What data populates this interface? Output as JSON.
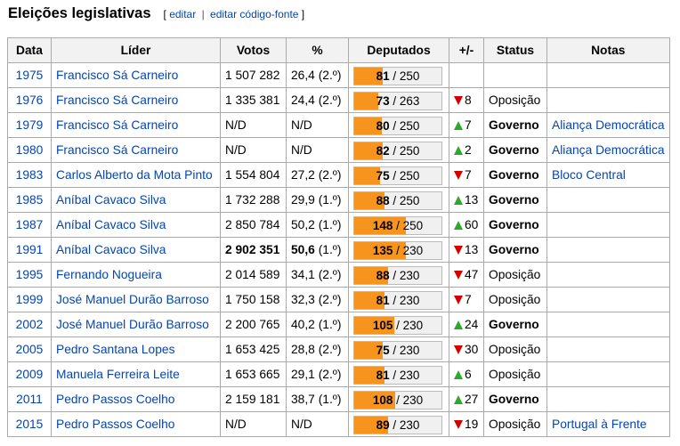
{
  "section": {
    "title": "Eleições legislativas",
    "edit_open": "[",
    "edit_label": "editar",
    "edit_sep": "|",
    "edit_source_label": "editar código-fonte",
    "edit_close": "]"
  },
  "table": {
    "headers": [
      "Data",
      "Líder",
      "Votos",
      "%",
      "Deputados",
      "+/-",
      "Status",
      "Notas"
    ],
    "rows": [
      {
        "year": "1975",
        "leader": "Francisco Sá Carneiro",
        "votes": "1 507 282",
        "pct": "26,4",
        "pos": "(2.º)",
        "seats": "81",
        "total": "250",
        "seat_fraction": 0.324,
        "dir": "",
        "change": "",
        "status": "",
        "status_bold": false,
        "notes": "",
        "bold_votes": false
      },
      {
        "year": "1976",
        "leader": "Francisco Sá Carneiro",
        "votes": "1 335 381",
        "pct": "24,4",
        "pos": "(2.º)",
        "seats": "73",
        "total": "263",
        "seat_fraction": 0.278,
        "dir": "down",
        "change": "8",
        "status": "Oposição",
        "status_bold": false,
        "notes": "",
        "bold_votes": false
      },
      {
        "year": "1979",
        "leader": "Francisco Sá Carneiro",
        "votes": "N/D",
        "pct": "N/D",
        "pos": "",
        "seats": "80",
        "total": "250",
        "seat_fraction": 0.32,
        "dir": "up",
        "change": "7",
        "status": "Governo",
        "status_bold": true,
        "notes": "Aliança Democrática",
        "bold_votes": false
      },
      {
        "year": "1980",
        "leader": "Francisco Sá Carneiro",
        "votes": "N/D",
        "pct": "N/D",
        "pos": "",
        "seats": "82",
        "total": "250",
        "seat_fraction": 0.328,
        "dir": "up",
        "change": "2",
        "status": "Governo",
        "status_bold": true,
        "notes": "Aliança Democrática",
        "bold_votes": false
      },
      {
        "year": "1983",
        "leader": "Carlos Alberto da Mota Pinto",
        "votes": "1 554 804",
        "pct": "27,2",
        "pos": "(2.º)",
        "seats": "75",
        "total": "250",
        "seat_fraction": 0.3,
        "dir": "down",
        "change": "7",
        "status": "Governo",
        "status_bold": true,
        "notes": "Bloco Central",
        "bold_votes": false
      },
      {
        "year": "1985",
        "leader": "Aníbal Cavaco Silva",
        "votes": "1 732 288",
        "pct": "29,9",
        "pos": "(1.º)",
        "seats": "88",
        "total": "250",
        "seat_fraction": 0.352,
        "dir": "up",
        "change": "13",
        "status": "Governo",
        "status_bold": true,
        "notes": "",
        "bold_votes": false
      },
      {
        "year": "1987",
        "leader": "Aníbal Cavaco Silva",
        "votes": "2 850 784",
        "pct": "50,2",
        "pos": "(1.º)",
        "seats": "148",
        "total": "250",
        "seat_fraction": 0.592,
        "dir": "up",
        "change": "60",
        "status": "Governo",
        "status_bold": true,
        "notes": "",
        "bold_votes": false
      },
      {
        "year": "1991",
        "leader": "Aníbal Cavaco Silva",
        "votes": "2 902 351",
        "pct": "50,6",
        "pos": "(1.º)",
        "seats": "135",
        "total": "230",
        "seat_fraction": 0.587,
        "dir": "down",
        "change": "13",
        "status": "Governo",
        "status_bold": true,
        "notes": "",
        "bold_votes": true
      },
      {
        "year": "1995",
        "leader": "Fernando Nogueira",
        "votes": "2 014 589",
        "pct": "34,1",
        "pos": "(2.º)",
        "seats": "88",
        "total": "230",
        "seat_fraction": 0.383,
        "dir": "down",
        "change": "47",
        "status": "Oposição",
        "status_bold": false,
        "notes": "",
        "bold_votes": false
      },
      {
        "year": "1999",
        "leader": "José Manuel Durão Barroso",
        "votes": "1 750 158",
        "pct": "32,3",
        "pos": "(2.º)",
        "seats": "81",
        "total": "230",
        "seat_fraction": 0.352,
        "dir": "down",
        "change": "7",
        "status": "Oposição",
        "status_bold": false,
        "notes": "",
        "bold_votes": false
      },
      {
        "year": "2002",
        "leader": "José Manuel Durão Barroso",
        "votes": "2 200 765",
        "pct": "40,2",
        "pos": "(1.º)",
        "seats": "105",
        "total": "230",
        "seat_fraction": 0.457,
        "dir": "up",
        "change": "24",
        "status": "Governo",
        "status_bold": true,
        "notes": "",
        "bold_votes": false
      },
      {
        "year": "2005",
        "leader": "Pedro Santana Lopes",
        "votes": "1 653 425",
        "pct": "28,8",
        "pos": "(2.º)",
        "seats": "75",
        "total": "230",
        "seat_fraction": 0.326,
        "dir": "down",
        "change": "30",
        "status": "Oposição",
        "status_bold": false,
        "notes": "",
        "bold_votes": false
      },
      {
        "year": "2009",
        "leader": "Manuela Ferreira Leite",
        "votes": "1 653 665",
        "pct": "29,1",
        "pos": "(2.º)",
        "seats": "81",
        "total": "230",
        "seat_fraction": 0.352,
        "dir": "up",
        "change": "6",
        "status": "Oposição",
        "status_bold": false,
        "notes": "",
        "bold_votes": false
      },
      {
        "year": "2011",
        "leader": "Pedro Passos Coelho",
        "votes": "2 159 181",
        "pct": "38,7",
        "pos": "(1.º)",
        "seats": "108",
        "total": "230",
        "seat_fraction": 0.47,
        "dir": "up",
        "change": "27",
        "status": "Governo",
        "status_bold": true,
        "notes": "",
        "bold_votes": false
      },
      {
        "year": "2015",
        "leader": "Pedro Passos Coelho",
        "votes": "N/D",
        "pct": "N/D",
        "pos": "",
        "seats": "89",
        "total": "230",
        "seat_fraction": 0.387,
        "dir": "down",
        "change": "19",
        "status": "Oposição",
        "status_bold": false,
        "notes": "Portugal à Frente",
        "bold_votes": false
      }
    ]
  },
  "colors": {
    "link": "#0645ad",
    "bar_fill": "#f7941d",
    "up": "#2ba92b",
    "down": "#d40000"
  }
}
